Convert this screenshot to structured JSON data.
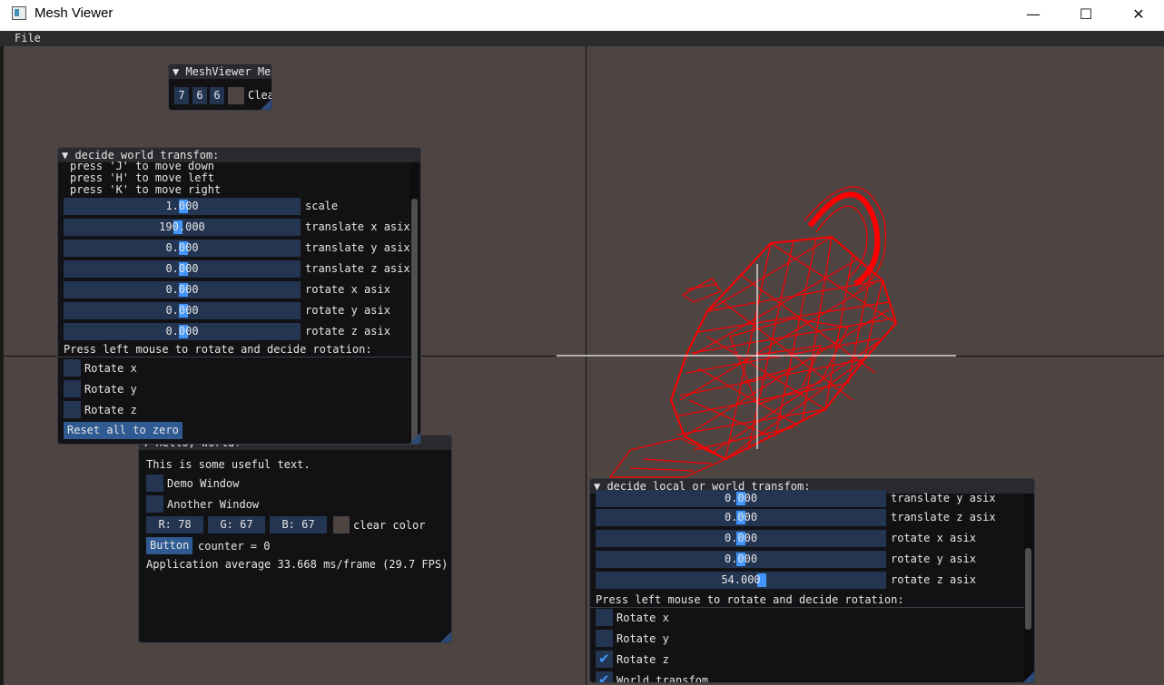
{
  "window": {
    "title": "Mesh Viewer",
    "minimize": "—",
    "maximize": "☐",
    "close": "✕"
  },
  "menu": {
    "file": "File"
  },
  "mini_panel": {
    "title": "▼ MeshViewer Menu",
    "v1": "7",
    "v2": "6",
    "v3": "6",
    "clear_label": "Clea"
  },
  "world_panel": {
    "title": "▼ decide world transfom:",
    "help": [
      "press 'J' to move down",
      "press 'H' to move left",
      "press 'K' to move right"
    ],
    "sliders": [
      {
        "value": "1.000",
        "label": "scale"
      },
      {
        "value": "190.000",
        "label": "translate x asix"
      },
      {
        "value": "0.000",
        "label": "translate y asix"
      },
      {
        "value": "0.000",
        "label": "translate z asix"
      },
      {
        "value": "0.000",
        "label": "rotate x asix"
      },
      {
        "value": "0.000",
        "label": "rotate y asix"
      },
      {
        "value": "0.000",
        "label": "rotate z asix"
      }
    ],
    "mouse_hint": "Press left mouse to rotate and decide rotation:",
    "checkboxes": [
      "Rotate x",
      "Rotate y",
      "Rotate z"
    ],
    "reset": "Reset all to zero"
  },
  "hello_panel": {
    "title": "▼ Hello, world!",
    "useful": "This is some useful text.",
    "demo": "Demo Window",
    "another": "Another Window",
    "r": "R: 78",
    "g": "G: 67",
    "b": "B: 67",
    "clear_color": "clear color",
    "button": "Button",
    "counter": "counter = 0",
    "fps": "Application average 33.668 ms/frame (29.7 FPS)"
  },
  "local_panel": {
    "title": "▼ decide local or world transfom:",
    "sliders": [
      {
        "value": "0.000",
        "label": "translate y asix"
      },
      {
        "value": "0.000",
        "label": "translate z asix"
      },
      {
        "value": "0.000",
        "label": "rotate x asix"
      },
      {
        "value": "0.000",
        "label": "rotate y asix"
      },
      {
        "value": "54.000",
        "label": "rotate z asix"
      }
    ],
    "mouse_hint": "Press left mouse to rotate and decide rotation:",
    "checkboxes": [
      {
        "label": "Rotate x",
        "checked": false
      },
      {
        "label": "Rotate y",
        "checked": false
      },
      {
        "label": "Rotate z",
        "checked": true
      },
      {
        "label": "World transfom",
        "checked": true
      }
    ]
  },
  "colors": {
    "background": "#4e4543",
    "mesh": "#ff0000",
    "slider": "#243552",
    "grab": "#4296fa",
    "button": "#2f5a92"
  }
}
